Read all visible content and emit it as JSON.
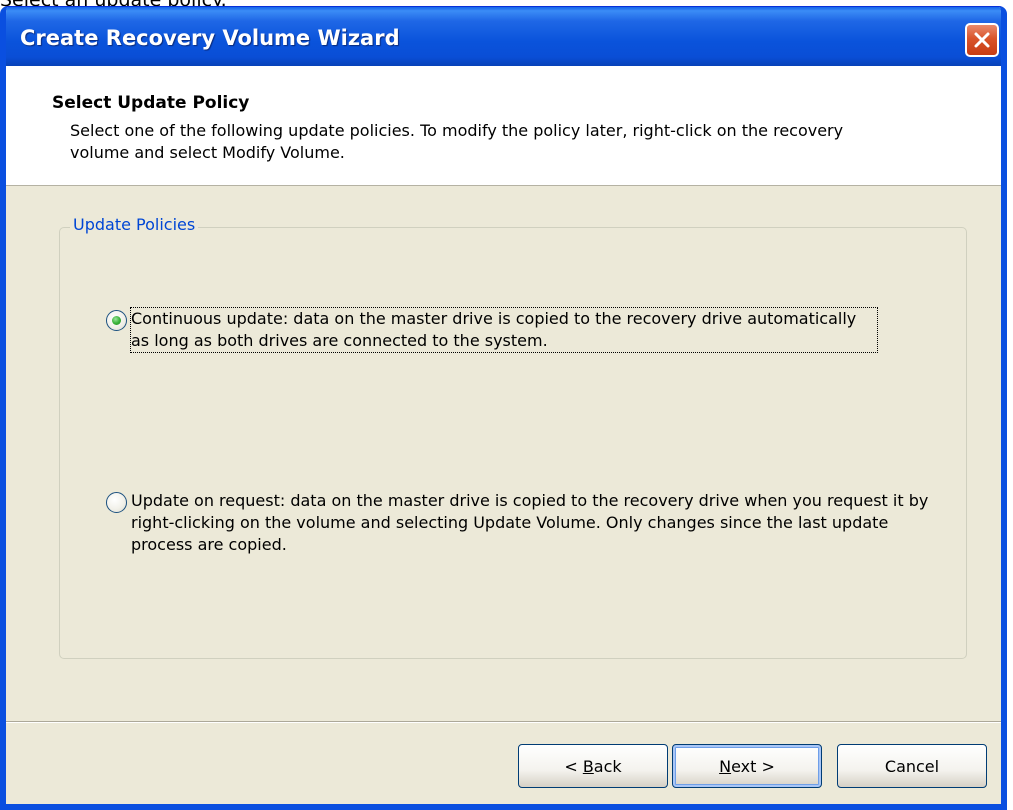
{
  "caption": "Select an update policy.",
  "window": {
    "title": "Create Recovery Volume Wizard",
    "close_icon": "close-icon"
  },
  "header": {
    "title": "Select Update Policy",
    "description": "Select one of the following update policies. To modify the policy later, right-click on the recovery volume and select Modify Volume."
  },
  "group": {
    "legend": "Update Policies",
    "options": [
      {
        "label": "Continuous update: data on the master drive is copied to the recovery drive automatically as long as both drives are connected to the system.",
        "selected": true
      },
      {
        "label": "Update on request: data on the master drive is copied to the recovery drive when you request it by right-clicking on the volume and selecting Update Volume. Only changes since the last update process are copied.",
        "selected": false
      }
    ]
  },
  "buttons": {
    "back_prefix": "< ",
    "back_mnemonic": "B",
    "back_rest": "ack",
    "next_mnemonic": "N",
    "next_rest": "ext >",
    "cancel": "Cancel"
  },
  "colors": {
    "titlebar": "#0a53db",
    "dialog_bg": "#ece9d8",
    "legend_text": "#0046d5",
    "close_button": "#d9542a",
    "radio_selected": "#3cb43c"
  }
}
